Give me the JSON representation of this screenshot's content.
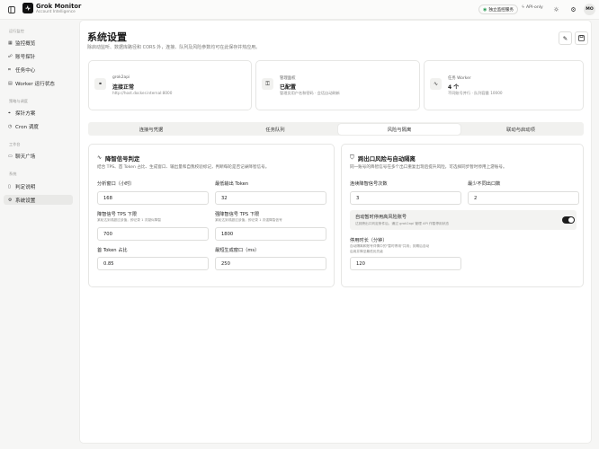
{
  "app": {
    "name": "Grok Monitor",
    "subtitle": "Account Intelligence"
  },
  "topbar": {
    "service_badge": "独立监控服务",
    "mode_badge": "API-only",
    "avatar": "MO"
  },
  "sidebar": {
    "groups": [
      {
        "label": "运行监控",
        "items": [
          {
            "label": "监控概览",
            "icon": "grid-icon"
          },
          {
            "label": "账号探针",
            "icon": "users-icon"
          },
          {
            "label": "任务中心",
            "icon": "tasks-icon"
          },
          {
            "label": "Worker 运行状态",
            "icon": "server-icon"
          }
        ]
      },
      {
        "label": "策略与调度",
        "items": [
          {
            "label": "探针方案",
            "icon": "probe-icon"
          },
          {
            "label": "Cron 调度",
            "icon": "clock-icon"
          }
        ]
      },
      {
        "label": "工作台",
        "items": [
          {
            "label": "聊天广场",
            "icon": "chat-icon"
          }
        ]
      },
      {
        "label": "系统",
        "items": [
          {
            "label": "判定说明",
            "icon": "doc-icon"
          },
          {
            "label": "系统设置",
            "icon": "gear-icon"
          }
        ]
      }
    ]
  },
  "page": {
    "title": "系统设置",
    "subtitle": "除启动监听、数据库路径和 CORS 外，连接、队列及风险参数均可在此保存并热应用。"
  },
  "status_cards": [
    {
      "icon": "link-icon",
      "caption": "grok2api",
      "title": "连接正常",
      "detail": "http://host.docker.internal:8000"
    },
    {
      "icon": "key-icon",
      "caption": "管理面权",
      "title": "已配置",
      "detail": "管理员用户名和密码 · 会话自动刷新"
    },
    {
      "icon": "pulse-icon",
      "caption": "任务 Worker",
      "title": "4 个",
      "detail": "不同账号并行 · 队列容量 10000"
    }
  ],
  "tabs": [
    "连接与凭据",
    "任务队列",
    "风险与隔离",
    "联动与启动项"
  ],
  "active_tab": 2,
  "degrade_card": {
    "title": "降智信号判定",
    "desc": "结合 TPS、首 Token 占比、生成窗口、输出量和自我校验标记，判断每轮是否记录降智信号。",
    "fields": {
      "window": {
        "label": "分析窗口（小时）",
        "value": "168"
      },
      "min_tokens": {
        "label": "最低输出 Token",
        "value": "32"
      },
      "tps_low": {
        "label": "降智信号 TPS 下限",
        "hint": "某轮达到或超过该值，即记录 1 次疑似降智",
        "value": "700"
      },
      "tps_strong": {
        "label": "强降智信号 TPS 下限",
        "hint": "某轮达到或超过该值，即记录 1 次强降智信号",
        "value": "1800"
      },
      "first_ratio": {
        "label": "首 Token 占比",
        "value": "0.85"
      },
      "min_window": {
        "label": "最短生成窗口（ms）",
        "value": "250"
      }
    }
  },
  "risk_card": {
    "title": "跨出口风险与自动隔离",
    "desc": "同一账号的降智信号在多个出口重复出现后提升风险，可选择同步暂时停用上游账号。",
    "fields": {
      "consecutive": {
        "label": "连续降智信号次数",
        "value": "3"
      },
      "min_exits": {
        "label": "最少不同出口数",
        "value": "2"
      },
      "auto_disable": {
        "label": "自动暂时停用高风险账号",
        "hint": "达到跨出口判定条件后，通过 grok2api 管理 API 作暂停用状态",
        "enabled": true
      },
      "duration": {
        "label": "停用时长（分钟）",
        "hint1": "自动隔离和账号详情中的\"暂时停用\"共用；到期后自动",
        "hint2": "启用并降至最低优先级",
        "value": "120"
      }
    }
  }
}
